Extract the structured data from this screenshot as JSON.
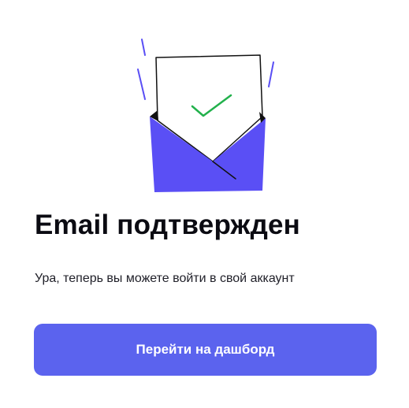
{
  "confirmation": {
    "title": "Email подтвержден",
    "message": "Ура, теперь вы можете войти в свой аккаунт",
    "cta_label": "Перейти на дашборд"
  },
  "illustration": {
    "icon": "email-envelope-with-checkmark-letter",
    "envelope_color": "#5a4ff5",
    "check_color": "#22b14c",
    "stroke_color": "#111111"
  },
  "colors": {
    "button_background": "#5b63ee",
    "button_text": "#ffffff",
    "title": "#0b0b12",
    "text": "#1f1f28"
  }
}
